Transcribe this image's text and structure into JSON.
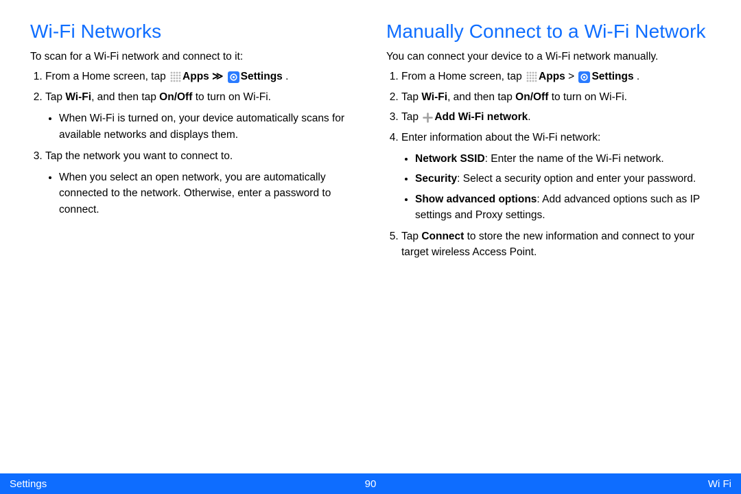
{
  "left": {
    "title": "Wi-Fi Networks",
    "intro": "To scan for a Wi-Fi network and connect to it:",
    "step1_pre": "From a Home screen, tap ",
    "apps_label": "Apps",
    "sep": " ≫ ",
    "settings_label": "Settings",
    "period": " .",
    "step2_pre": "Tap ",
    "step2_wifi": "Wi-Fi",
    "step2_mid": ", and then tap ",
    "step2_onoff": "On/Off",
    "step2_post": " to turn on Wi-Fi.",
    "step2_bullet": "When Wi-Fi is turned on, your device automatically scans for available networks and displays them.",
    "step3": "Tap the network you want to connect to.",
    "step3_bullet": "When you select an open network, you are automatically connected to the network. Otherwise, enter a password to connect."
  },
  "right": {
    "title": "Manually Connect to a Wi-Fi Network",
    "intro": "You can connect your device to a Wi-Fi network manually.",
    "step1_pre": "From a Home screen, tap ",
    "apps_label": "Apps",
    "sep": " >  ",
    "settings_label": "Settings",
    "period": " .",
    "step2_pre": "Tap ",
    "step2_wifi": "Wi-Fi",
    "step2_mid": ", and then tap ",
    "step2_onoff": "On/Off",
    "step2_post": " to turn on Wi-Fi.",
    "step3_pre": "Tap ",
    "step3_add": "Add Wi-Fi network",
    "step3_post": ".",
    "step4": "Enter information about the Wi-Fi network:",
    "b1_bold": "Network SSID",
    "b1_rest": ": Enter the name of the Wi-Fi network.",
    "b2_bold": "Security",
    "b2_rest": ": Select a security option and enter your password.",
    "b3_bold": "Show advanced options",
    "b3_rest": ": Add advanced options such as IP settings and Proxy settings.",
    "step5_pre": "Tap ",
    "step5_connect": "Connect",
    "step5_post": " to store the new information and connect to your target wireless Access Point."
  },
  "footer": {
    "left": "Settings",
    "page": "90",
    "right": "Wi Fi"
  }
}
